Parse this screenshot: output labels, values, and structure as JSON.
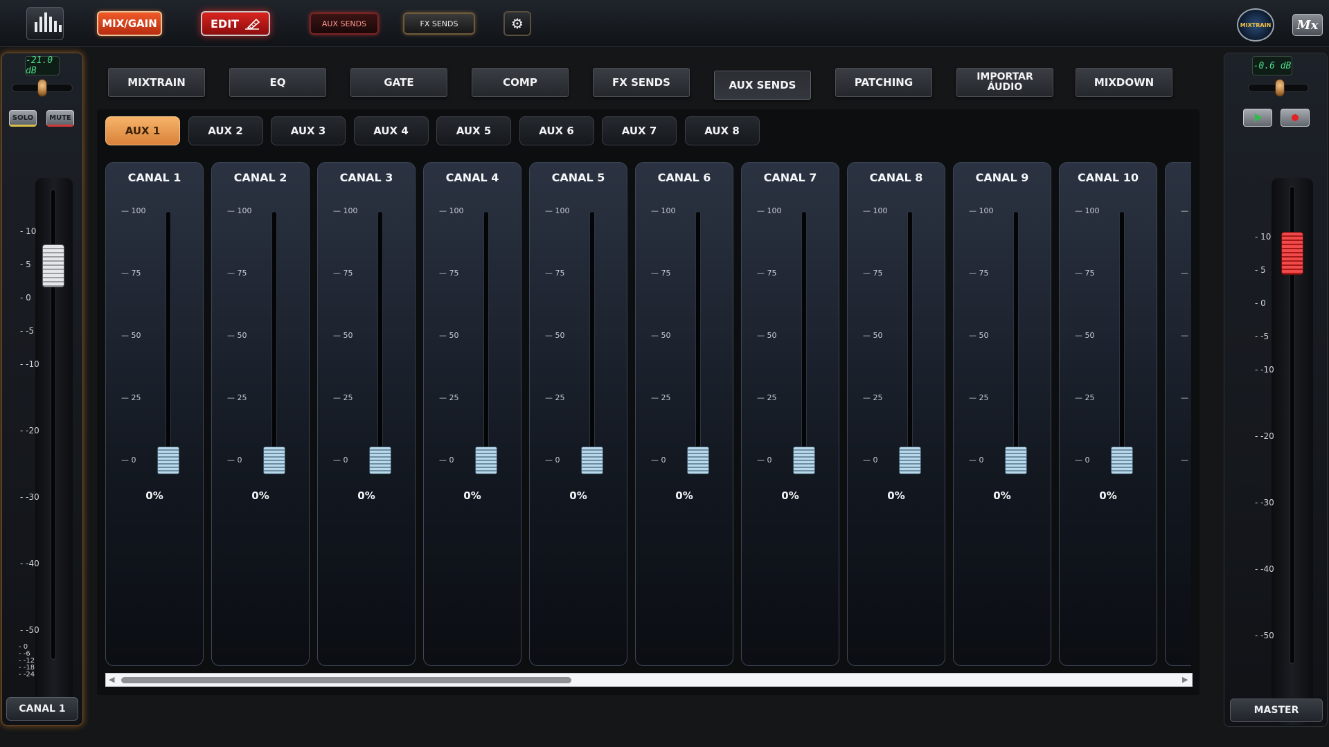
{
  "toolbar": {
    "mixgain_label": "MIX/GAIN",
    "edit_label": "EDIT",
    "auxsends_label": "AUX SENDS",
    "fxsends_label": "FX SENDS",
    "settings_icon": "gear-icon",
    "brand_logo_text": "MIXTRAIN",
    "mx_label": "Mx"
  },
  "left_strip": {
    "db_display": "-21.0 dB",
    "solo_label": "SOLO",
    "mute_label": "MUTE",
    "scale": [
      "10",
      "5",
      "0",
      "-5",
      "-10",
      "-20",
      "-30",
      "-40",
      "-50"
    ],
    "meter_scale": [
      "0",
      "-6",
      "-12",
      "-18",
      "-24"
    ],
    "name": "CANAL 1"
  },
  "right_strip": {
    "db_display": "-0.6 dB",
    "play_icon": "play-icon",
    "record_icon": "record-icon",
    "scale": [
      "10",
      "5",
      "0",
      "-5",
      "-10",
      "-20",
      "-30",
      "-40",
      "-50"
    ],
    "name": "MASTER"
  },
  "section_tabs": [
    {
      "label": "MIXTRAIN"
    },
    {
      "label": "EQ"
    },
    {
      "label": "GATE"
    },
    {
      "label": "COMP"
    },
    {
      "label": "FX SENDS"
    },
    {
      "label": "AUX SENDS",
      "active": true
    },
    {
      "label": "PATCHING"
    },
    {
      "label": "IMPORTAR\nÁUDIO"
    },
    {
      "label": "MIXDOWN"
    }
  ],
  "aux_tabs": [
    {
      "label": "AUX 1",
      "active": true
    },
    {
      "label": "AUX 2"
    },
    {
      "label": "AUX 3"
    },
    {
      "label": "AUX 4"
    },
    {
      "label": "AUX 5"
    },
    {
      "label": "AUX 6"
    },
    {
      "label": "AUX 7"
    },
    {
      "label": "AUX 8"
    }
  ],
  "channel_scale": [
    "100",
    "75",
    "50",
    "25",
    "0"
  ],
  "channels": [
    {
      "name": "CANAL 1",
      "value": "0%",
      "level": 0
    },
    {
      "name": "CANAL 2",
      "value": "0%",
      "level": 0
    },
    {
      "name": "CANAL 3",
      "value": "0%",
      "level": 0
    },
    {
      "name": "CANAL 4",
      "value": "0%",
      "level": 0
    },
    {
      "name": "CANAL 5",
      "value": "0%",
      "level": 0
    },
    {
      "name": "CANAL 6",
      "value": "0%",
      "level": 0
    },
    {
      "name": "CANAL 7",
      "value": "0%",
      "level": 0
    },
    {
      "name": "CANAL 8",
      "value": "0%",
      "level": 0
    },
    {
      "name": "CANAL 9",
      "value": "0%",
      "level": 0
    },
    {
      "name": "CANAL 10",
      "value": "0%",
      "level": 0
    },
    {
      "name": "C",
      "value": "",
      "level": 0
    }
  ],
  "colors": {
    "accent_orange": "#f7b36a",
    "edit_red": "#d8241f",
    "display_green": "#4fd98a"
  }
}
